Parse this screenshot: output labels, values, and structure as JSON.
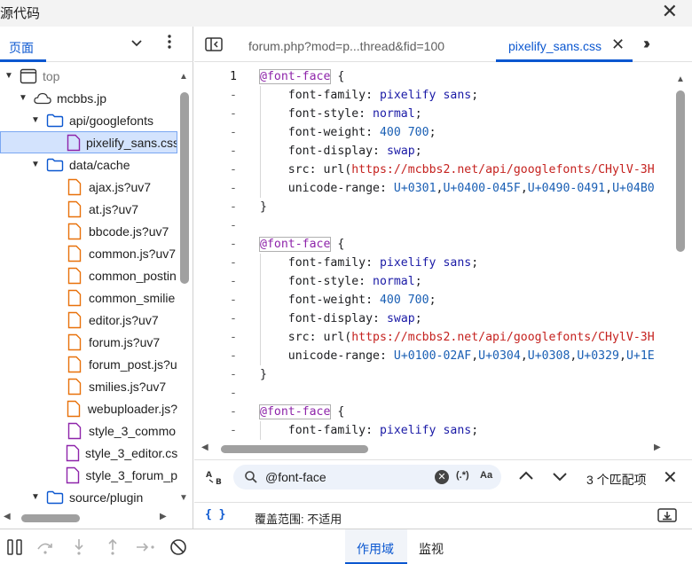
{
  "window": {
    "title": "源代码"
  },
  "navigator": {
    "tab_label": "页面",
    "tree": [
      {
        "label": "top",
        "level": 0,
        "type": "frame",
        "expanded": true,
        "muted": true
      },
      {
        "label": "mcbbs.jp",
        "level": 1,
        "type": "cloud",
        "expanded": true
      },
      {
        "label": "api/googlefonts",
        "level": 2,
        "type": "folder",
        "expanded": true
      },
      {
        "label": "pixelify_sans.css",
        "level": 3,
        "type": "css",
        "selected": true
      },
      {
        "label": "data/cache",
        "level": 2,
        "type": "folder",
        "expanded": true
      },
      {
        "label": "ajax.js?uv7",
        "level": 3,
        "type": "js"
      },
      {
        "label": "at.js?uv7",
        "level": 3,
        "type": "js"
      },
      {
        "label": "bbcode.js?uv7",
        "level": 3,
        "type": "js"
      },
      {
        "label": "common.js?uv7",
        "level": 3,
        "type": "js"
      },
      {
        "label": "common_postin",
        "level": 3,
        "type": "js"
      },
      {
        "label": "common_smilie",
        "level": 3,
        "type": "js"
      },
      {
        "label": "editor.js?uv7",
        "level": 3,
        "type": "js"
      },
      {
        "label": "forum.js?uv7",
        "level": 3,
        "type": "js"
      },
      {
        "label": "forum_post.js?u",
        "level": 3,
        "type": "js"
      },
      {
        "label": "smilies.js?uv7",
        "level": 3,
        "type": "js"
      },
      {
        "label": "webuploader.js?",
        "level": 3,
        "type": "js"
      },
      {
        "label": "style_3_commo",
        "level": 3,
        "type": "css"
      },
      {
        "label": "style_3_editor.cs",
        "level": 3,
        "type": "css"
      },
      {
        "label": "style_3_forum_p",
        "level": 3,
        "type": "css"
      },
      {
        "label": "source/plugin",
        "level": 2,
        "type": "folder",
        "expanded": true
      }
    ]
  },
  "editor": {
    "tabs": [
      {
        "label": "forum.php?mod=p...thread&fid=100",
        "active": false
      },
      {
        "label": "pixelify_sans.css",
        "active": true
      }
    ],
    "lines": [
      {
        "num": "1",
        "kind": "at"
      },
      {
        "num": "-",
        "prop": "font-family",
        "val": "pixelify sans",
        "vtype": "val"
      },
      {
        "num": "-",
        "prop": "font-style",
        "val": "normal",
        "vtype": "val"
      },
      {
        "num": "-",
        "prop": "font-weight",
        "val": "400 700",
        "vtype": "num"
      },
      {
        "num": "-",
        "prop": "font-display",
        "val": "swap",
        "vtype": "val"
      },
      {
        "num": "-",
        "prop": "src",
        "val": "https://mcbbs2.net/api/googlefonts/CHylV-3H",
        "vtype": "url"
      },
      {
        "num": "-",
        "prop": "unicode-range",
        "val": "U+0301,U+0400-045F,U+0490-0491,U+04B0",
        "vtype": "range"
      },
      {
        "num": "-",
        "kind": "close"
      },
      {
        "num": "-",
        "kind": "blank"
      },
      {
        "num": "-",
        "kind": "at"
      },
      {
        "num": "-",
        "prop": "font-family",
        "val": "pixelify sans",
        "vtype": "val"
      },
      {
        "num": "-",
        "prop": "font-style",
        "val": "normal",
        "vtype": "val"
      },
      {
        "num": "-",
        "prop": "font-weight",
        "val": "400 700",
        "vtype": "num"
      },
      {
        "num": "-",
        "prop": "font-display",
        "val": "swap",
        "vtype": "val"
      },
      {
        "num": "-",
        "prop": "src",
        "val": "https://mcbbs2.net/api/googlefonts/CHylV-3H",
        "vtype": "url"
      },
      {
        "num": "-",
        "prop": "unicode-range",
        "val": "U+0100-02AF,U+0304,U+0308,U+0329,U+1E",
        "vtype": "range"
      },
      {
        "num": "-",
        "kind": "close"
      },
      {
        "num": "-",
        "kind": "blank"
      },
      {
        "num": "-",
        "kind": "at"
      },
      {
        "num": "-",
        "prop": "font-family",
        "val": "pixelify sans",
        "vtype": "val"
      }
    ],
    "at_rule": "@font-face",
    "url_func": "url"
  },
  "search": {
    "query": "@font-face",
    "regex_label": "(.*)",
    "case_label": "Aa",
    "replace_toggle": "A→B",
    "match_count": "3 个匹配项"
  },
  "status": {
    "braces": "{ }",
    "coverage": "覆盖范围: 不适用"
  },
  "bottom": {
    "tabs": [
      {
        "label": "作用域",
        "active": true
      },
      {
        "label": "监视",
        "active": false
      }
    ]
  },
  "colors": {
    "accent": "#0b57d0",
    "selected_row": "#d3e3fd",
    "at_rule": "#8e24aa",
    "url": "#c5221f",
    "js_file": "#e8710a",
    "css_file": "#8e24aa"
  },
  "icons": [
    "close-icon",
    "chevron-down-icon",
    "kebab-menu-icon",
    "toggle-sidebar-icon",
    "more-tabs-icon",
    "search-icon",
    "clear-icon",
    "arrow-up-icon",
    "arrow-down-icon",
    "download-icon",
    "pause-icon",
    "step-over-icon",
    "step-into-icon",
    "step-out-icon",
    "step-icon",
    "deactivate-breakpoints-icon"
  ]
}
